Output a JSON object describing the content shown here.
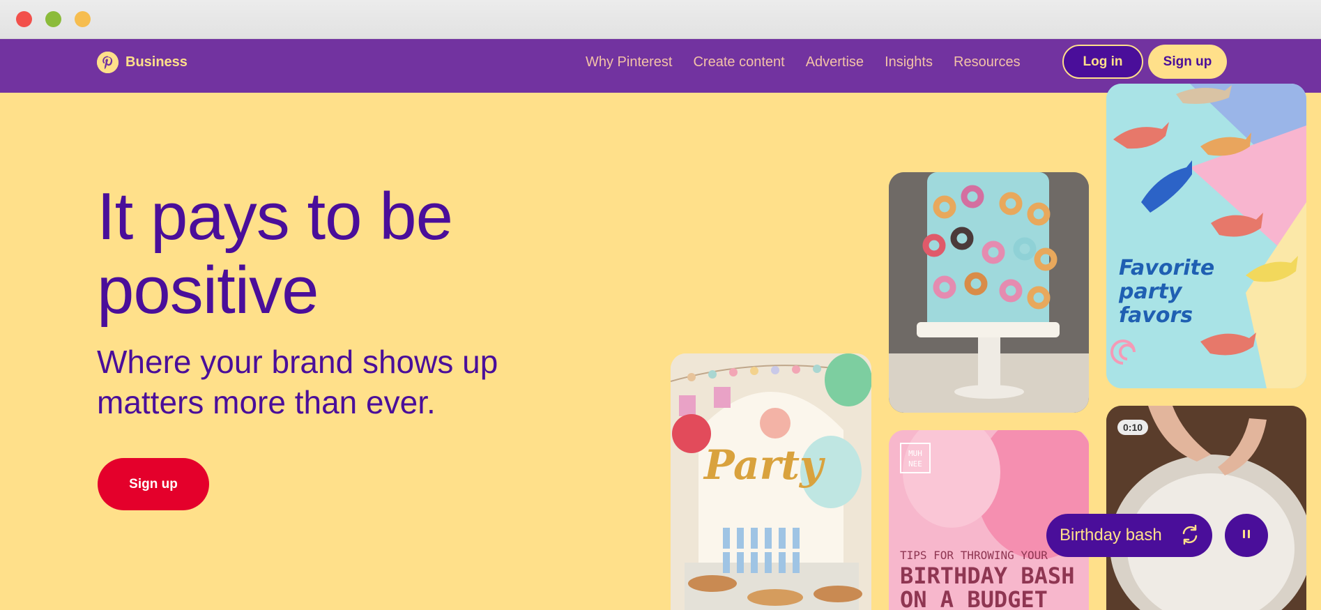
{
  "brand": {
    "label": "Business",
    "logo_icon": "pinterest-logo-icon",
    "accent": "#ffe08a",
    "nav_bg": "#7233a0"
  },
  "nav": {
    "links": [
      "Why Pinterest",
      "Create content",
      "Advertise",
      "Insights",
      "Resources"
    ],
    "login_label": "Log in",
    "signup_label": "Sign up"
  },
  "hero": {
    "title": "It pays to be positive",
    "subtitle": "Where your brand shows up matters more than ever.",
    "cta_label": "Sign up",
    "title_color": "#4a0e9a",
    "cta_color": "#e4002b"
  },
  "tiles": {
    "favors_text": "Favorite party favors",
    "party_text": "Party",
    "tips_small": "TIPS FOR THROWING YOUR",
    "tips_big": "BIRTHDAY BASH ON A BUDGET",
    "muh_logo": "MUH NEE",
    "video_time": "0:10"
  },
  "controls": {
    "topic_label": "Birthday bash",
    "refresh_icon": "refresh-icon",
    "pause_icon": "pause-icon"
  }
}
